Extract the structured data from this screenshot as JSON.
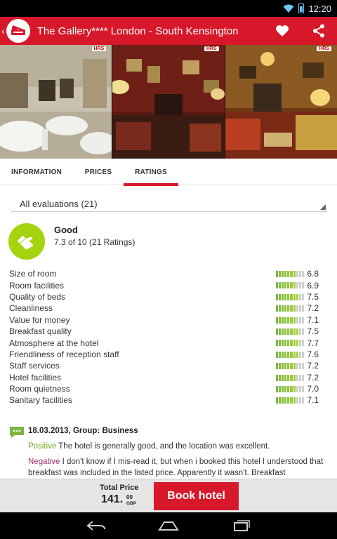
{
  "status_bar": {
    "time": "12:20"
  },
  "header": {
    "title": "The Gallery**** London - South Kensington"
  },
  "photos": [
    {
      "badge": "HRS"
    },
    {
      "badge": "HRS"
    },
    {
      "badge": "HRS"
    }
  ],
  "tabs": [
    {
      "label": "INFORMATION",
      "active": false
    },
    {
      "label": "PRICES",
      "active": false
    },
    {
      "label": "RATINGS",
      "active": true
    }
  ],
  "filter": {
    "selected": "All evaluations (21)"
  },
  "overall": {
    "label": "Good",
    "score_text": "7.3 of 10 (21 Ratings)",
    "color": "#a3d40f"
  },
  "criteria": [
    {
      "name": "Size of room",
      "value": "6.8",
      "filled": 7
    },
    {
      "name": "Room facilities",
      "value": "6.9",
      "filled": 7
    },
    {
      "name": "Quality of beds",
      "value": "7.5",
      "filled": 8
    },
    {
      "name": "Cleanliness",
      "value": "7.2",
      "filled": 7
    },
    {
      "name": "Value for money",
      "value": "7.1",
      "filled": 7
    },
    {
      "name": "Breakfast quality",
      "value": "7.5",
      "filled": 8
    },
    {
      "name": "Atmosphere at the hotel",
      "value": "7.7",
      "filled": 8
    },
    {
      "name": "Friendliness of reception staff",
      "value": "7.6",
      "filled": 8
    },
    {
      "name": "Staff services",
      "value": "7.2",
      "filled": 7
    },
    {
      "name": "Hotel facilities",
      "value": "7.2",
      "filled": 7
    },
    {
      "name": "Room quietness",
      "value": "7.0",
      "filled": 7
    },
    {
      "name": "Sanitary facilities",
      "value": "7.1",
      "filled": 7
    }
  ],
  "review": {
    "header": "18.03.2013, Group: Business",
    "positive_label": "Positive",
    "positive_text": "The hotel is generally good, and the location was excellent.",
    "negative_label": "Negative",
    "negative_text": "I don't know if I mis-read it, but when i booked this hotel I understood that breakfast was included in the listed price. Apparently it wasn't. Breakfast"
  },
  "booking": {
    "total_label": "Total Price",
    "price_whole": "141.",
    "price_cents": "00",
    "currency": "GBP",
    "button_label": "Book hotel"
  },
  "colors": {
    "brand": "#d7182a",
    "positive": "#6aa816",
    "negative": "#a0316b",
    "bar_good": "#8cc63f"
  }
}
